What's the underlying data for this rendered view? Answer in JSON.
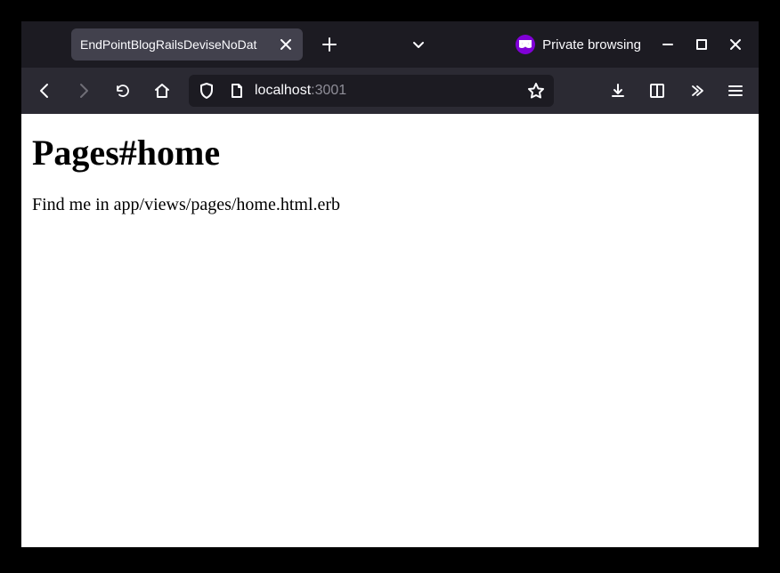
{
  "tab": {
    "title": "EndPointBlogRailsDeviseNoDat"
  },
  "private_browsing_label": "Private browsing",
  "url": {
    "domain": "localhost",
    "port": ":3001"
  },
  "page": {
    "heading": "Pages#home",
    "body_text": "Find me in app/views/pages/home.html.erb"
  }
}
